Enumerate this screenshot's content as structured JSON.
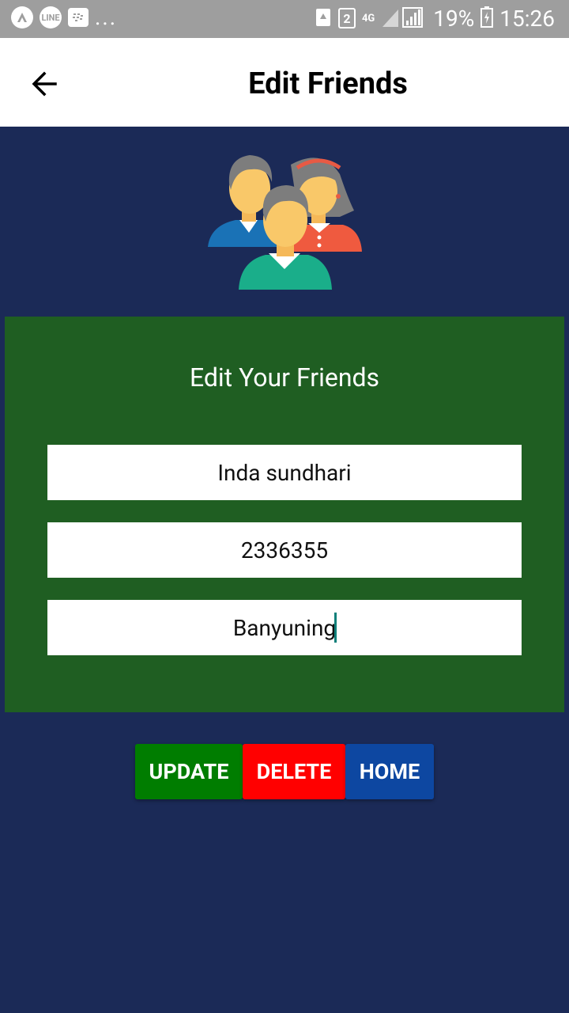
{
  "status_bar": {
    "left_icons": [
      "android-auto-icon",
      "line-icon",
      "bbm-icon"
    ],
    "line_label": "LINE",
    "overflow": "...",
    "sim_label": "2",
    "network": "4G",
    "battery": "19%",
    "time": "15:26"
  },
  "header": {
    "title": "Edit Friends",
    "back_icon": "arrow-back-icon"
  },
  "card": {
    "title": "Edit Your Friends",
    "bg_color": "#1f5e22",
    "fields": [
      {
        "value": "Inda sundhari"
      },
      {
        "value": "2336355"
      },
      {
        "value": "Banyuning"
      }
    ]
  },
  "buttons": {
    "update": "UPDATE",
    "delete": "DELETE",
    "home": "HOME"
  },
  "colors": {
    "background": "#1b2a57",
    "update": "#007d00",
    "delete": "#ff0000",
    "home": "#0d47a1"
  }
}
